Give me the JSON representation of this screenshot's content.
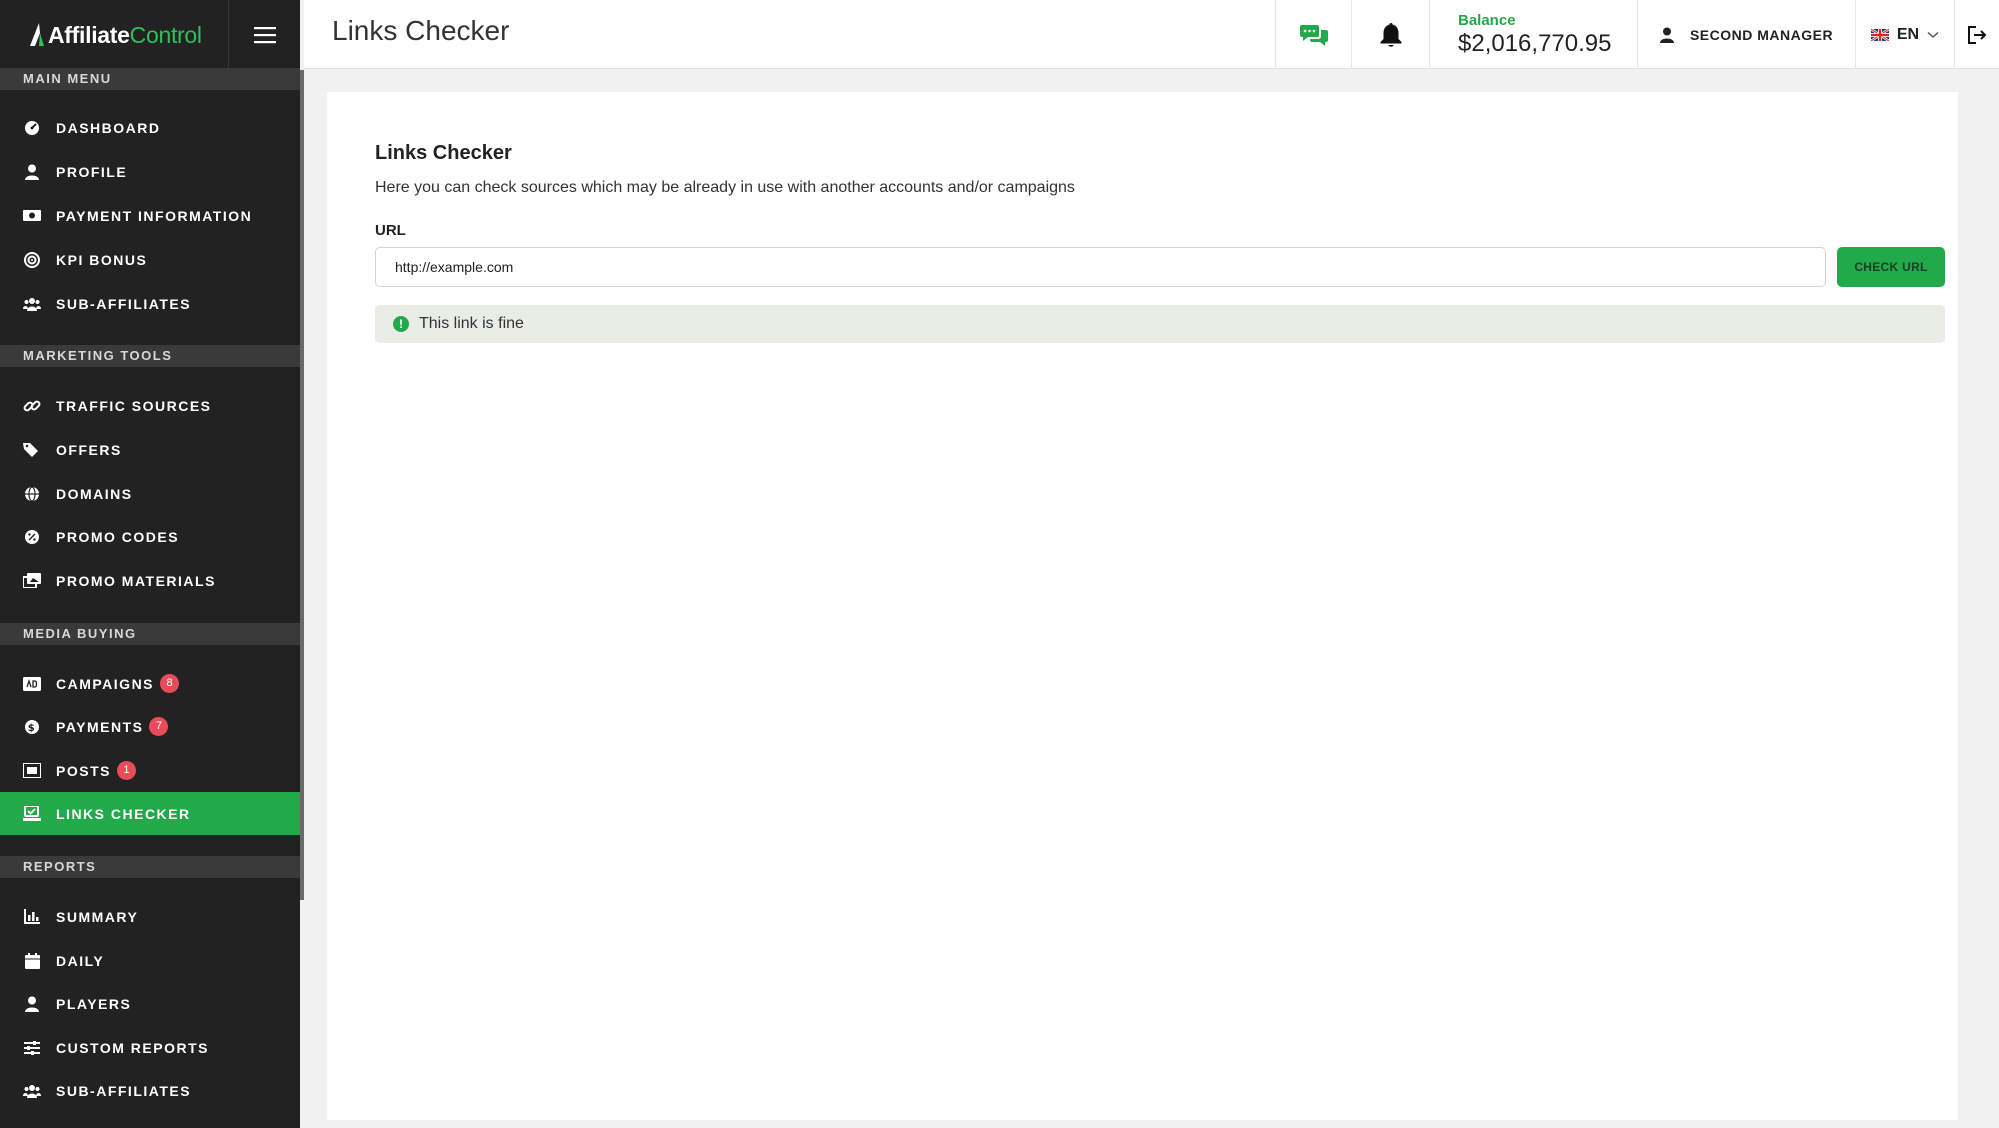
{
  "brand": {
    "name_part1": "Affiliate",
    "name_part2": "Control",
    "accent_color": "#22a94a"
  },
  "header": {
    "title": "Links Checker",
    "balance_label": "Balance",
    "balance_value": "$2,016,770.95",
    "user_name": "SECOND MANAGER",
    "language": "EN"
  },
  "sidebar": {
    "sections": [
      {
        "title": "MAIN MENU"
      },
      {
        "title": "MARKETING TOOLS"
      },
      {
        "title": "MEDIA BUYING"
      },
      {
        "title": "REPORTS"
      }
    ],
    "items": [
      {
        "label": "DASHBOARD",
        "icon": "dashboard-icon"
      },
      {
        "label": "PROFILE",
        "icon": "user-icon"
      },
      {
        "label": "PAYMENT INFORMATION",
        "icon": "money-icon"
      },
      {
        "label": "KPI BONUS",
        "icon": "target-icon"
      },
      {
        "label": "SUB-AFFILIATES",
        "icon": "users-icon"
      },
      {
        "label": "TRAFFIC SOURCES",
        "icon": "link-icon"
      },
      {
        "label": "OFFERS",
        "icon": "tags-icon"
      },
      {
        "label": "DOMAINS",
        "icon": "globe-icon"
      },
      {
        "label": "PROMO CODES",
        "icon": "percent-icon"
      },
      {
        "label": "PROMO MATERIALS",
        "icon": "images-icon"
      },
      {
        "label": "CAMPAIGNS",
        "icon": "ad-icon",
        "badge": "8"
      },
      {
        "label": "PAYMENTS",
        "icon": "dollar-icon",
        "badge": "7"
      },
      {
        "label": "POSTS",
        "icon": "posts-icon",
        "badge": "1"
      },
      {
        "label": "LINKS CHECKER",
        "icon": "link-check-icon",
        "active": true
      },
      {
        "label": "SUMMARY",
        "icon": "chart-icon"
      },
      {
        "label": "DAILY",
        "icon": "calendar-icon"
      },
      {
        "label": "PLAYERS",
        "icon": "player-icon"
      },
      {
        "label": "CUSTOM REPORTS",
        "icon": "sliders-icon"
      },
      {
        "label": "SUB-AFFILIATES",
        "icon": "users-icon"
      }
    ]
  },
  "content": {
    "title": "Links Checker",
    "description": "Here you can check sources which may be already in use with another accounts and/or campaigns",
    "url_label": "URL",
    "url_value": "http://example.com",
    "check_button": "CHECK URL",
    "result_text": "This link is fine",
    "result_icon": "!"
  }
}
